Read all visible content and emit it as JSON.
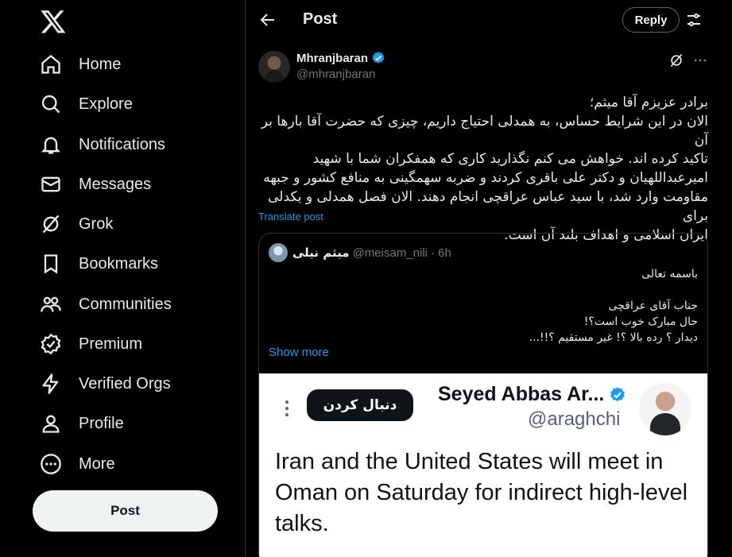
{
  "sidebar": {
    "logo_icon": "x-logo-icon",
    "items": [
      {
        "label": "Home",
        "icon": "home-icon"
      },
      {
        "label": "Explore",
        "icon": "search-icon"
      },
      {
        "label": "Notifications",
        "icon": "bell-icon"
      },
      {
        "label": "Messages",
        "icon": "envelope-icon"
      },
      {
        "label": "Grok",
        "icon": "grok-icon"
      },
      {
        "label": "Bookmarks",
        "icon": "bookmark-icon"
      },
      {
        "label": "Communities",
        "icon": "communities-icon"
      },
      {
        "label": "Premium",
        "icon": "premium-icon"
      },
      {
        "label": "Verified Orgs",
        "icon": "lightning-icon"
      },
      {
        "label": "Profile",
        "icon": "person-icon"
      },
      {
        "label": "More",
        "icon": "more-circle-icon"
      }
    ],
    "post_label": "Post"
  },
  "header": {
    "title": "Post",
    "reply_label": "Reply"
  },
  "tweet": {
    "author_name": "Mhranjbaran",
    "author_handle": "@mhranjbaran",
    "lines": [
      "برادر عزیزم آقا میثم؛",
      "الان در این شرایط حساس، به همدلی احتیاج داریم، چیزی که حضرت آقا بارها بر آن",
      "تاکید کرده اند. خواهش می کنم نگذارید کاری که همفکران شما با شهید",
      "امیرعبداللهیان و دکتر علی باقری کردند و ضربه سهمگینی به منافع کشور و جبهه",
      "مقاومت وارد شد، با سید عباس عراقچی انجام دهند. الان فصل همدلی و یکدلی برای",
      "ایران اسلامی و اهداف بلند آن است."
    ],
    "translate_label": "Translate post"
  },
  "quote": {
    "name": "میثم نیلی",
    "handle": "@meisam_nili",
    "time": "· 6h",
    "lines": [
      "باسمه تعالی",
      "",
      "جناب آقای عراقچی",
      "حال مبارک خوب است؟!",
      "دیدار ؟  رده بالا ؟!  غیر مستقیم ؟!!..."
    ],
    "show_more": "Show more"
  },
  "media": {
    "follow_label": "دنبال کردن",
    "name": "Seyed Abbas Ar...",
    "handle": "@araghchi",
    "text": "Iran and the United States will meet in Oman on Saturday for indirect high-level talks."
  },
  "colors": {
    "accent": "#1d9bf0",
    "verified": "#1d9bf0",
    "background": "#000000"
  }
}
